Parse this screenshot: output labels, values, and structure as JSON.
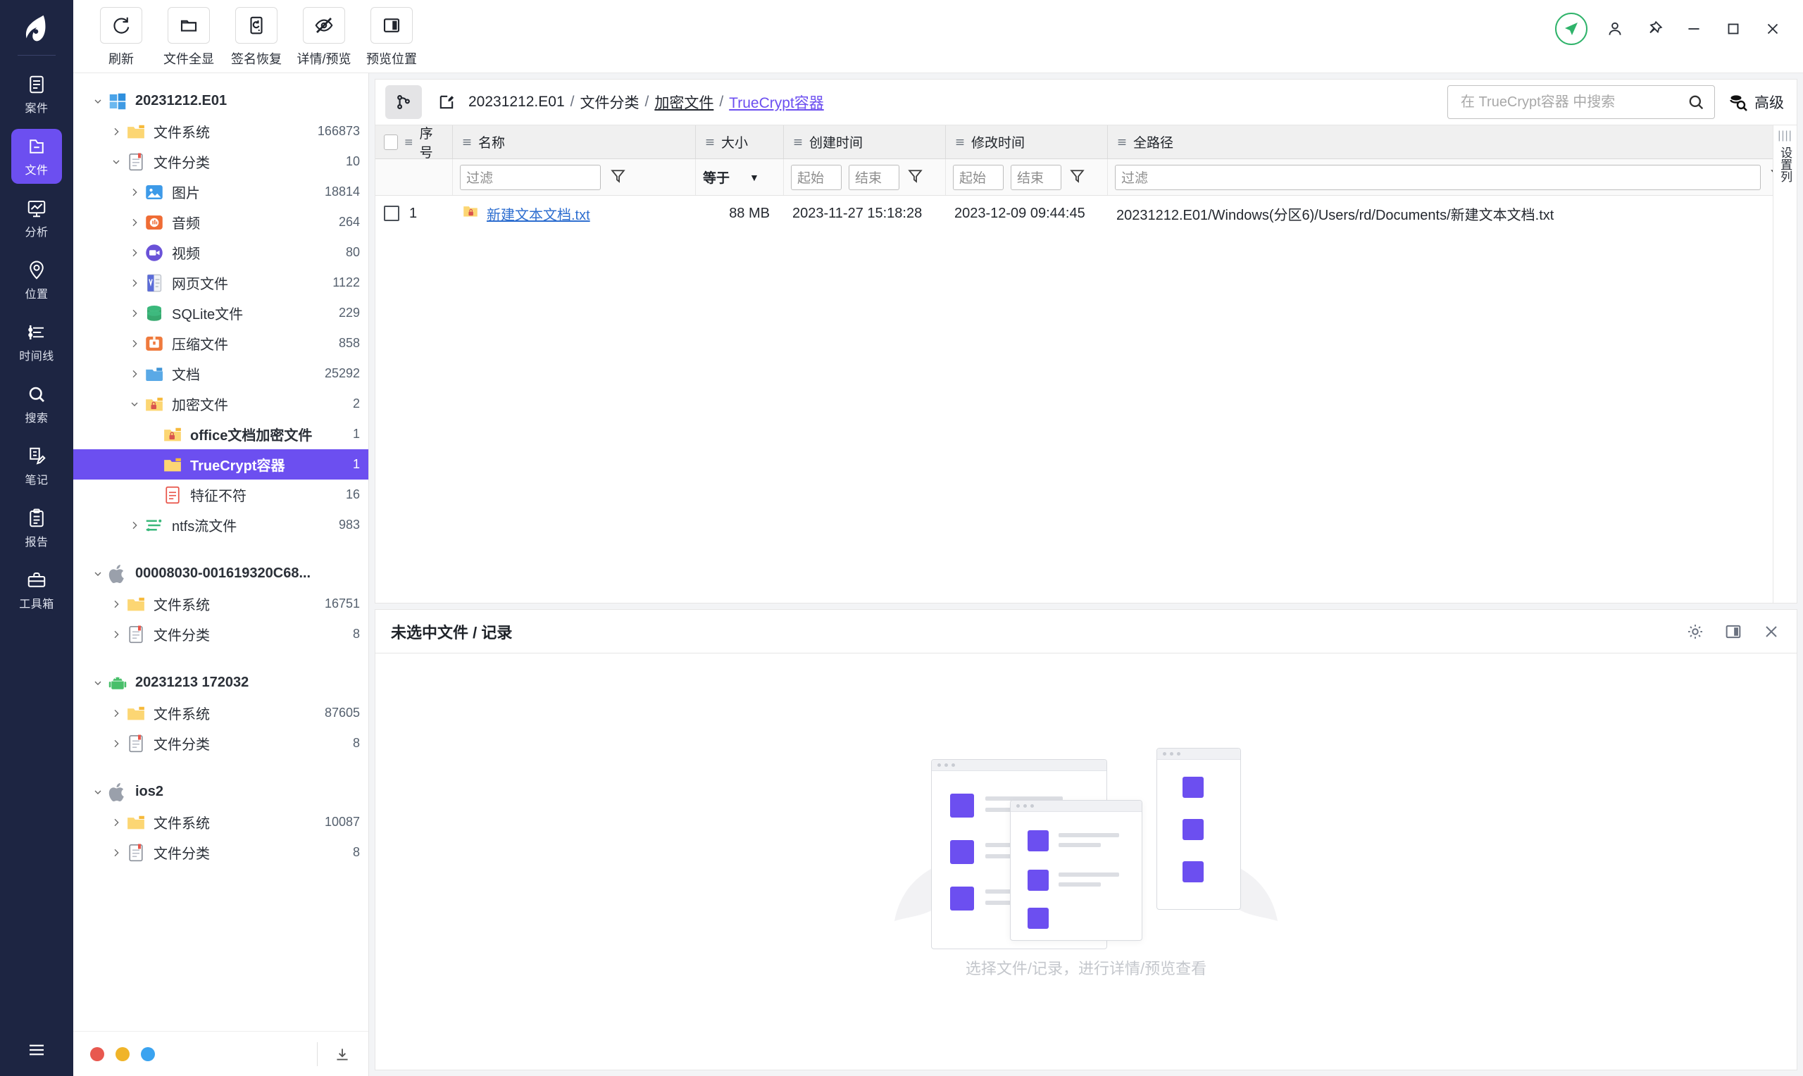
{
  "rail": {
    "items": [
      {
        "label": "案件",
        "icon": "case-icon",
        "active": false
      },
      {
        "label": "文件",
        "icon": "file-icon",
        "active": true
      },
      {
        "label": "分析",
        "icon": "analysis-icon",
        "active": false
      },
      {
        "label": "位置",
        "icon": "location-icon",
        "active": false
      },
      {
        "label": "时间线",
        "icon": "timeline-icon",
        "active": false
      },
      {
        "label": "搜索",
        "icon": "search-icon",
        "active": false
      },
      {
        "label": "笔记",
        "icon": "note-icon",
        "active": false
      },
      {
        "label": "报告",
        "icon": "report-icon",
        "active": false
      },
      {
        "label": "工具箱",
        "icon": "toolbox-icon",
        "active": false
      }
    ],
    "menu_icon": "hamburger-icon"
  },
  "toolbar": {
    "buttons": [
      {
        "label": "刷新",
        "icon": "refresh-icon"
      },
      {
        "label": "文件全显",
        "icon": "folder-icon"
      },
      {
        "label": "签名恢复",
        "icon": "signature-restore-icon"
      },
      {
        "label": "详情/预览",
        "icon": "eye-off-icon"
      },
      {
        "label": "预览位置",
        "icon": "panel-layout-icon"
      }
    ],
    "status_icon": "send-status-icon",
    "window_controls": [
      {
        "name": "user-icon",
        "glyph": "user"
      },
      {
        "name": "pin-icon",
        "glyph": "pin"
      },
      {
        "name": "minimize-icon",
        "glyph": "minimize"
      },
      {
        "name": "maximize-icon",
        "glyph": "maximize"
      },
      {
        "name": "close-icon",
        "glyph": "close"
      }
    ]
  },
  "tree": {
    "nodes": [
      {
        "label": "20231212.E01",
        "count": "",
        "depth": 0,
        "caret": "down",
        "icon": "windows-icon",
        "bold": true,
        "selected": false
      },
      {
        "label": "文件系统",
        "count": "166873",
        "depth": 1,
        "caret": "right",
        "icon": "folder-icon",
        "bold": false,
        "selected": false
      },
      {
        "label": "文件分类",
        "count": "10",
        "depth": 1,
        "caret": "down",
        "icon": "doc-icon",
        "bold": false,
        "selected": false
      },
      {
        "label": "图片",
        "count": "18814",
        "depth": 2,
        "caret": "right",
        "icon": "image-icon",
        "bold": false,
        "selected": false
      },
      {
        "label": "音频",
        "count": "264",
        "depth": 2,
        "caret": "right",
        "icon": "audio-icon",
        "bold": false,
        "selected": false
      },
      {
        "label": "视频",
        "count": "80",
        "depth": 2,
        "caret": "right",
        "icon": "video-icon",
        "bold": false,
        "selected": false
      },
      {
        "label": "网页文件",
        "count": "1122",
        "depth": 2,
        "caret": "right",
        "icon": "web-icon",
        "bold": false,
        "selected": false
      },
      {
        "label": "SQLite文件",
        "count": "229",
        "depth": 2,
        "caret": "right",
        "icon": "sqlite-icon",
        "bold": false,
        "selected": false
      },
      {
        "label": "压缩文件",
        "count": "858",
        "depth": 2,
        "caret": "right",
        "icon": "zip-icon",
        "bold": false,
        "selected": false
      },
      {
        "label": "文档",
        "count": "25292",
        "depth": 2,
        "caret": "right",
        "icon": "document-icon",
        "bold": false,
        "selected": false
      },
      {
        "label": "加密文件",
        "count": "2",
        "depth": 2,
        "caret": "down",
        "icon": "lock-folder-icon",
        "bold": false,
        "selected": false
      },
      {
        "label": "office文档加密文件",
        "count": "1",
        "depth": 3,
        "caret": "none",
        "icon": "lock-folder-icon",
        "bold": true,
        "selected": false
      },
      {
        "label": "TrueCrypt容器",
        "count": "1",
        "depth": 3,
        "caret": "none",
        "icon": "folder-open-icon",
        "bold": true,
        "selected": true
      },
      {
        "label": "特征不符",
        "count": "16",
        "depth": 3,
        "caret": "none",
        "icon": "mismatch-icon",
        "bold": false,
        "selected": false
      },
      {
        "label": "ntfs流文件",
        "count": "983",
        "depth": 2,
        "caret": "right",
        "icon": "stream-icon",
        "bold": false,
        "selected": false
      },
      {
        "gap": true
      },
      {
        "label": "00008030-001619320C68...",
        "count": "",
        "depth": 0,
        "caret": "down",
        "icon": "apple-icon",
        "bold": true,
        "selected": false
      },
      {
        "label": "文件系统",
        "count": "16751",
        "depth": 1,
        "caret": "right",
        "icon": "folder-icon",
        "bold": false,
        "selected": false
      },
      {
        "label": "文件分类",
        "count": "8",
        "depth": 1,
        "caret": "right",
        "icon": "doc-icon",
        "bold": false,
        "selected": false
      },
      {
        "gap": true
      },
      {
        "label": "20231213 172032",
        "count": "",
        "depth": 0,
        "caret": "down",
        "icon": "android-icon",
        "bold": true,
        "selected": false
      },
      {
        "label": "文件系统",
        "count": "87605",
        "depth": 1,
        "caret": "right",
        "icon": "folder-icon",
        "bold": false,
        "selected": false
      },
      {
        "label": "文件分类",
        "count": "8",
        "depth": 1,
        "caret": "right",
        "icon": "doc-icon",
        "bold": false,
        "selected": false
      },
      {
        "gap": true
      },
      {
        "label": "ios2",
        "count": "",
        "depth": 0,
        "caret": "down",
        "icon": "apple-icon",
        "bold": true,
        "selected": false
      },
      {
        "label": "文件系统",
        "count": "10087",
        "depth": 1,
        "caret": "right",
        "icon": "folder-icon",
        "bold": false,
        "selected": false
      },
      {
        "label": "文件分类",
        "count": "8",
        "depth": 1,
        "caret": "right",
        "icon": "doc-icon",
        "bold": false,
        "selected": false
      }
    ],
    "footer_dots": [
      "#e8584f",
      "#f0b429",
      "#3aa3f0"
    ],
    "footer_icon": "collapse-icon"
  },
  "breadcrumb": {
    "branch_icon": "branch-icon",
    "edit_icon": "edit-icon",
    "root": "20231212.E01",
    "sep": "/",
    "parts": [
      {
        "text": "文件分类",
        "style": "plain"
      },
      {
        "text": "加密文件",
        "style": "link"
      },
      {
        "text": "TrueCrypt容器",
        "style": "current"
      }
    ]
  },
  "search": {
    "placeholder": "在 TrueCrypt容器 中搜索",
    "value": "",
    "icon": "search-icon",
    "advanced_label": "高级",
    "advanced_icon": "advanced-search-icon"
  },
  "table": {
    "columns": [
      {
        "key": "seq",
        "label": "序号"
      },
      {
        "key": "name",
        "label": "名称"
      },
      {
        "key": "size",
        "label": "大小"
      },
      {
        "key": "ctime",
        "label": "创建时间"
      },
      {
        "key": "mtime",
        "label": "修改时间"
      },
      {
        "key": "path",
        "label": "全路径"
      }
    ],
    "filters": {
      "name_placeholder": "过滤",
      "size_operator": "等于",
      "ctime_start": "起始",
      "ctime_end": "结束",
      "mtime_start": "起始",
      "mtime_end": "结束",
      "path_placeholder": "过滤"
    },
    "rows": [
      {
        "seq": "1",
        "name": "新建文本文档.txt",
        "size": "88 MB",
        "ctime": "2023-11-27 15:18:28",
        "mtime": "2023-12-09 09:44:45",
        "path": "20231212.E01/Windows(分区6)/Users/rd/Documents/新建文本文档.txt",
        "icon": "locked-file-icon",
        "checked": false
      }
    ],
    "side_strip_label": "设置列"
  },
  "detail": {
    "title": "未选中文件 / 记录",
    "actions": [
      {
        "name": "settings-icon"
      },
      {
        "name": "panel-layout-icon"
      },
      {
        "name": "close-icon"
      }
    ],
    "empty_caption": "选择文件/记录，进行详情/预览查看"
  },
  "colors": {
    "accent": "#6c4ff0",
    "rail_bg": "#1d2542",
    "link": "#2f6fd0",
    "status_green": "#2fb36a"
  }
}
